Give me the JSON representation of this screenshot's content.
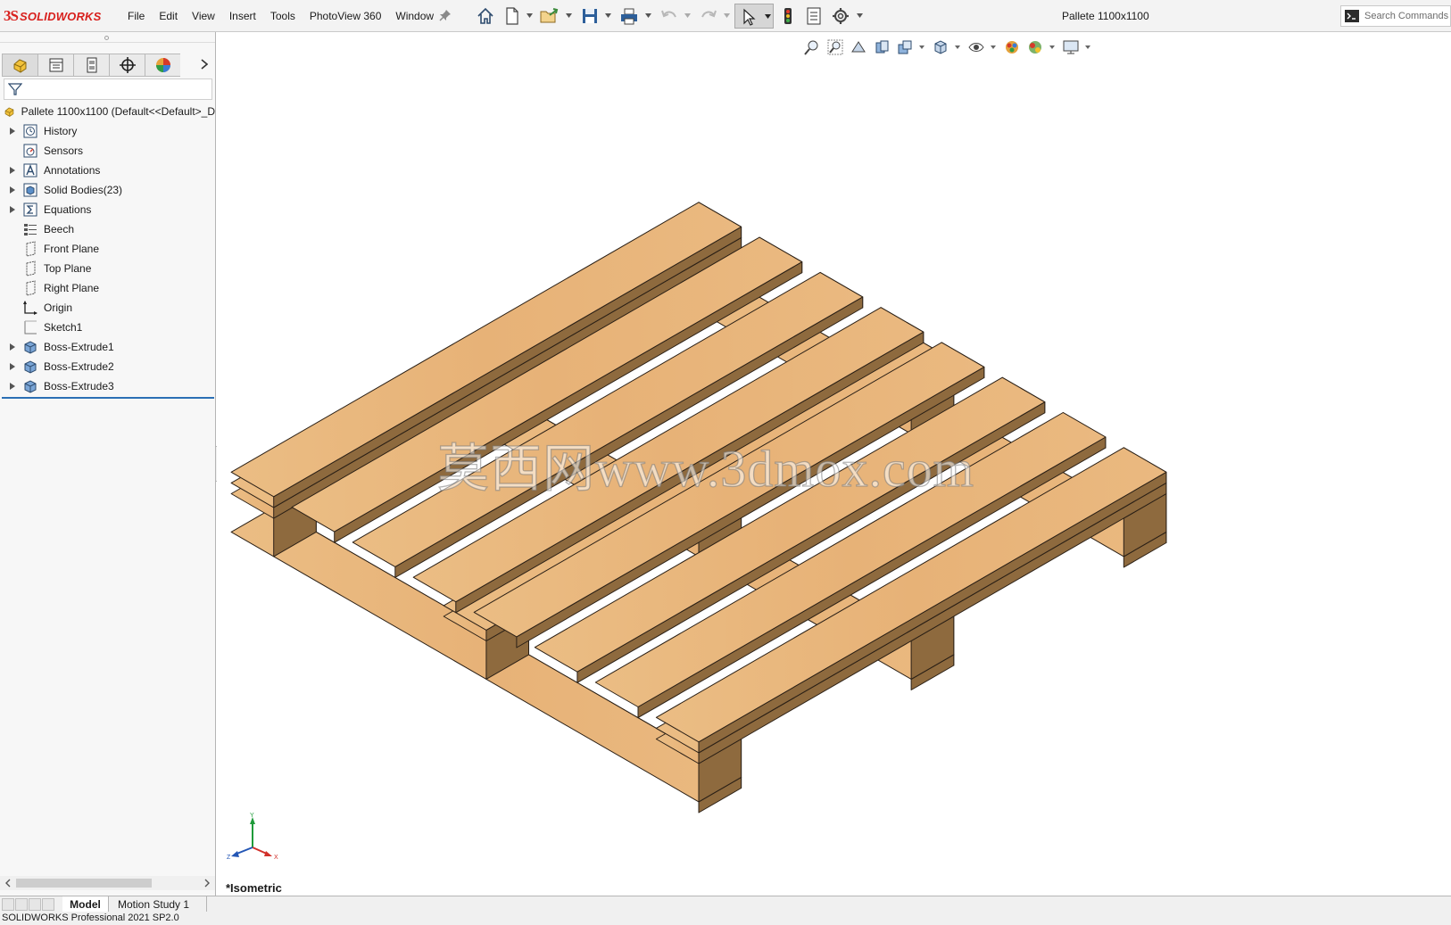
{
  "app": {
    "brand_ds": "3S",
    "brand_name": "SOLIDWORKS",
    "document_title": "Pallete 1100x1100",
    "status": "SOLIDWORKS Professional 2021 SP2.0"
  },
  "menu": [
    "File",
    "Edit",
    "View",
    "Insert",
    "Tools",
    "PhotoView 360",
    "Window"
  ],
  "toolbar": {
    "icons": [
      "home-icon",
      "new-document-icon",
      "open-icon",
      "save-icon",
      "print-icon",
      "undo-icon",
      "redo-icon",
      "select-icon",
      "rebuild-icon",
      "file-properties-icon",
      "options-icon"
    ],
    "search_placeholder": "Search Commands"
  },
  "manager_tabs": [
    "featuremanager-tab",
    "propertymanager-tab",
    "configurationmanager-tab",
    "dimxpertmanager-tab",
    "displaymanager-tab"
  ],
  "tree": {
    "root": "Pallete 1100x1100  (Default<<Default>_D",
    "items": [
      {
        "label": "History",
        "icon": "history-icon",
        "expandable": true
      },
      {
        "label": "Sensors",
        "icon": "sensors-icon",
        "expandable": false
      },
      {
        "label": "Annotations",
        "icon": "annotations-icon",
        "expandable": true
      },
      {
        "label": "Solid Bodies(23)",
        "icon": "solid-bodies-icon",
        "expandable": true
      },
      {
        "label": "Equations",
        "icon": "equations-icon",
        "expandable": true
      },
      {
        "label": "Beech",
        "icon": "material-icon",
        "expandable": false
      },
      {
        "label": "Front Plane",
        "icon": "plane-icon",
        "expandable": false
      },
      {
        "label": "Top Plane",
        "icon": "plane-icon",
        "expandable": false
      },
      {
        "label": "Right Plane",
        "icon": "plane-icon",
        "expandable": false
      },
      {
        "label": "Origin",
        "icon": "origin-icon",
        "expandable": false
      },
      {
        "label": "Sketch1",
        "icon": "sketch-icon",
        "expandable": false
      },
      {
        "label": "Boss-Extrude1",
        "icon": "extrude-icon",
        "expandable": true
      },
      {
        "label": "Boss-Extrude2",
        "icon": "extrude-icon",
        "expandable": true
      },
      {
        "label": "Boss-Extrude3",
        "icon": "extrude-icon",
        "expandable": true
      }
    ]
  },
  "viewport": {
    "view_name": "*Isometric",
    "watermark": "莫西网www.3dmox.com",
    "triad": {
      "x": "X",
      "y": "Y",
      "z": "Z"
    }
  },
  "bottom_tabs": [
    "Model",
    "Motion Study 1"
  ],
  "colors": {
    "brand_red": "#d8201d",
    "wood_top": "#e8b57a",
    "wood_side": "#c4955c",
    "wood_dark": "#8e6a3e",
    "accent_blue": "#2b6fb5"
  }
}
